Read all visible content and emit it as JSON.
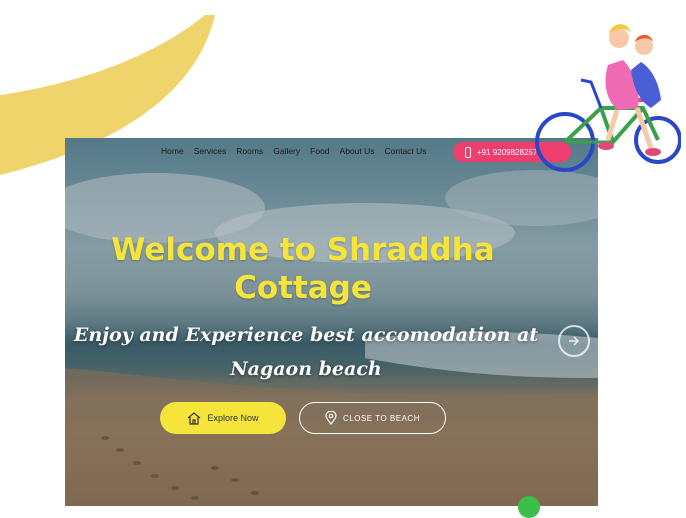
{
  "nav": {
    "items": [
      "Home",
      "Services",
      "Rooms",
      "Gallery",
      "Food",
      "About Us",
      "Contact Us"
    ],
    "phone": "+91 9209828257"
  },
  "hero": {
    "title": "Welcome to Shraddha Cottage",
    "subtitle": "Enjoy and Experience best accomodation at Nagaon beach",
    "explore_label": "Explore Now",
    "beach_label": "CLOSE TO BEACH"
  },
  "colors": {
    "accent_yellow": "#f5e53a",
    "phone_pink": "#ee3e6d",
    "swoosh": "#efd36b"
  },
  "icons": [
    "home-icon",
    "location-pin-icon",
    "phone-icon",
    "chevron-right-icon"
  ]
}
